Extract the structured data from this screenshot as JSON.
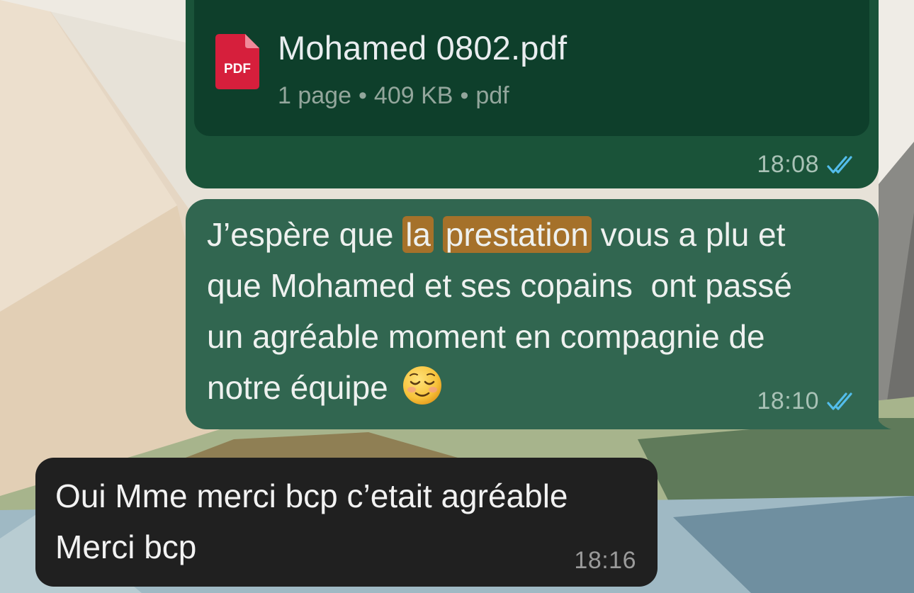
{
  "colors": {
    "outgoing_bubble": "#316650",
    "document_bubble": "#1a5339",
    "incoming_bubble": "#202020",
    "highlight": "#a5712a",
    "read_ticks": "#53bdeb",
    "pdf_red": "#d61f3c"
  },
  "document_message": {
    "icon": "pdf-file-icon",
    "icon_label": "PDF",
    "file_name": "Mohamed 0802.pdf",
    "pages": "1 page",
    "size": "409 KB",
    "type": "pdf",
    "separator": "•",
    "time": "18:08",
    "status_icon": "double-check-read-icon"
  },
  "text_message": {
    "line1_before": "J’espère que ",
    "highlight1": "la",
    "highlight2": "prestation",
    "line1_after": " vous a plu et",
    "line2": "que Mohamed et ses copains  ont passé",
    "line3": "un agréable moment en compagnie de",
    "line4": "notre équipe",
    "emoji": "smiling-face-icon",
    "time": "18:10",
    "status_icon": "double-check-read-icon"
  },
  "incoming_message": {
    "line1": "Oui Mme merci bcp c’etait agréable",
    "line2": "Merci bcp",
    "time": "18:16"
  }
}
